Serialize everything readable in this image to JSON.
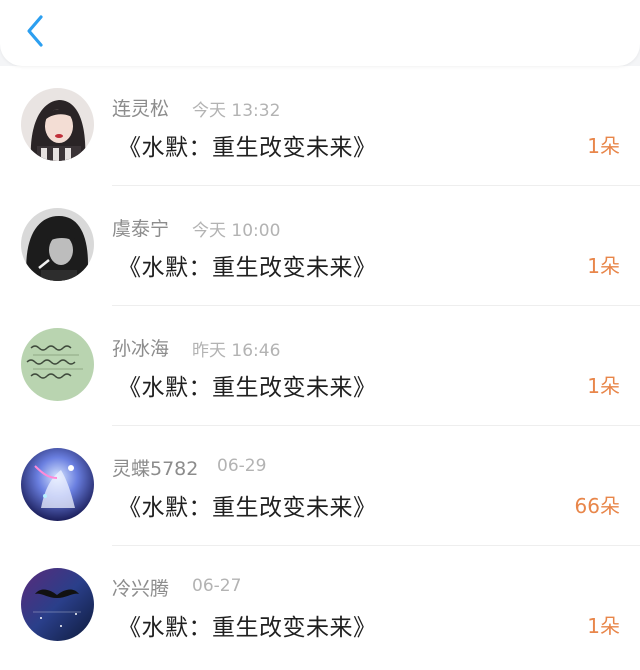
{
  "header": {
    "back_icon": "chevron-left-icon"
  },
  "colors": {
    "accent_blue": "#2c9ff0",
    "gift_orange": "#e8864a",
    "name_gray": "#8c8c8c",
    "time_gray": "#b3b3b3"
  },
  "items": [
    {
      "name": "连灵松",
      "time": "今天 13:32",
      "title": "《水默：重生改变未来》",
      "count": "1朵"
    },
    {
      "name": "虞泰宁",
      "time": "今天 10:00",
      "title": "《水默：重生改变未来》",
      "count": "1朵"
    },
    {
      "name": "孙冰海",
      "time": "昨天 16:46",
      "title": "《水默：重生改变未来》",
      "count": "1朵"
    },
    {
      "name": "灵蝶5782",
      "time": "06-29",
      "title": "《水默：重生改变未来》",
      "count": "66朵"
    },
    {
      "name": "冷兴腾",
      "time": "06-27",
      "title": "《水默：重生改变未来》",
      "count": "1朵"
    }
  ]
}
